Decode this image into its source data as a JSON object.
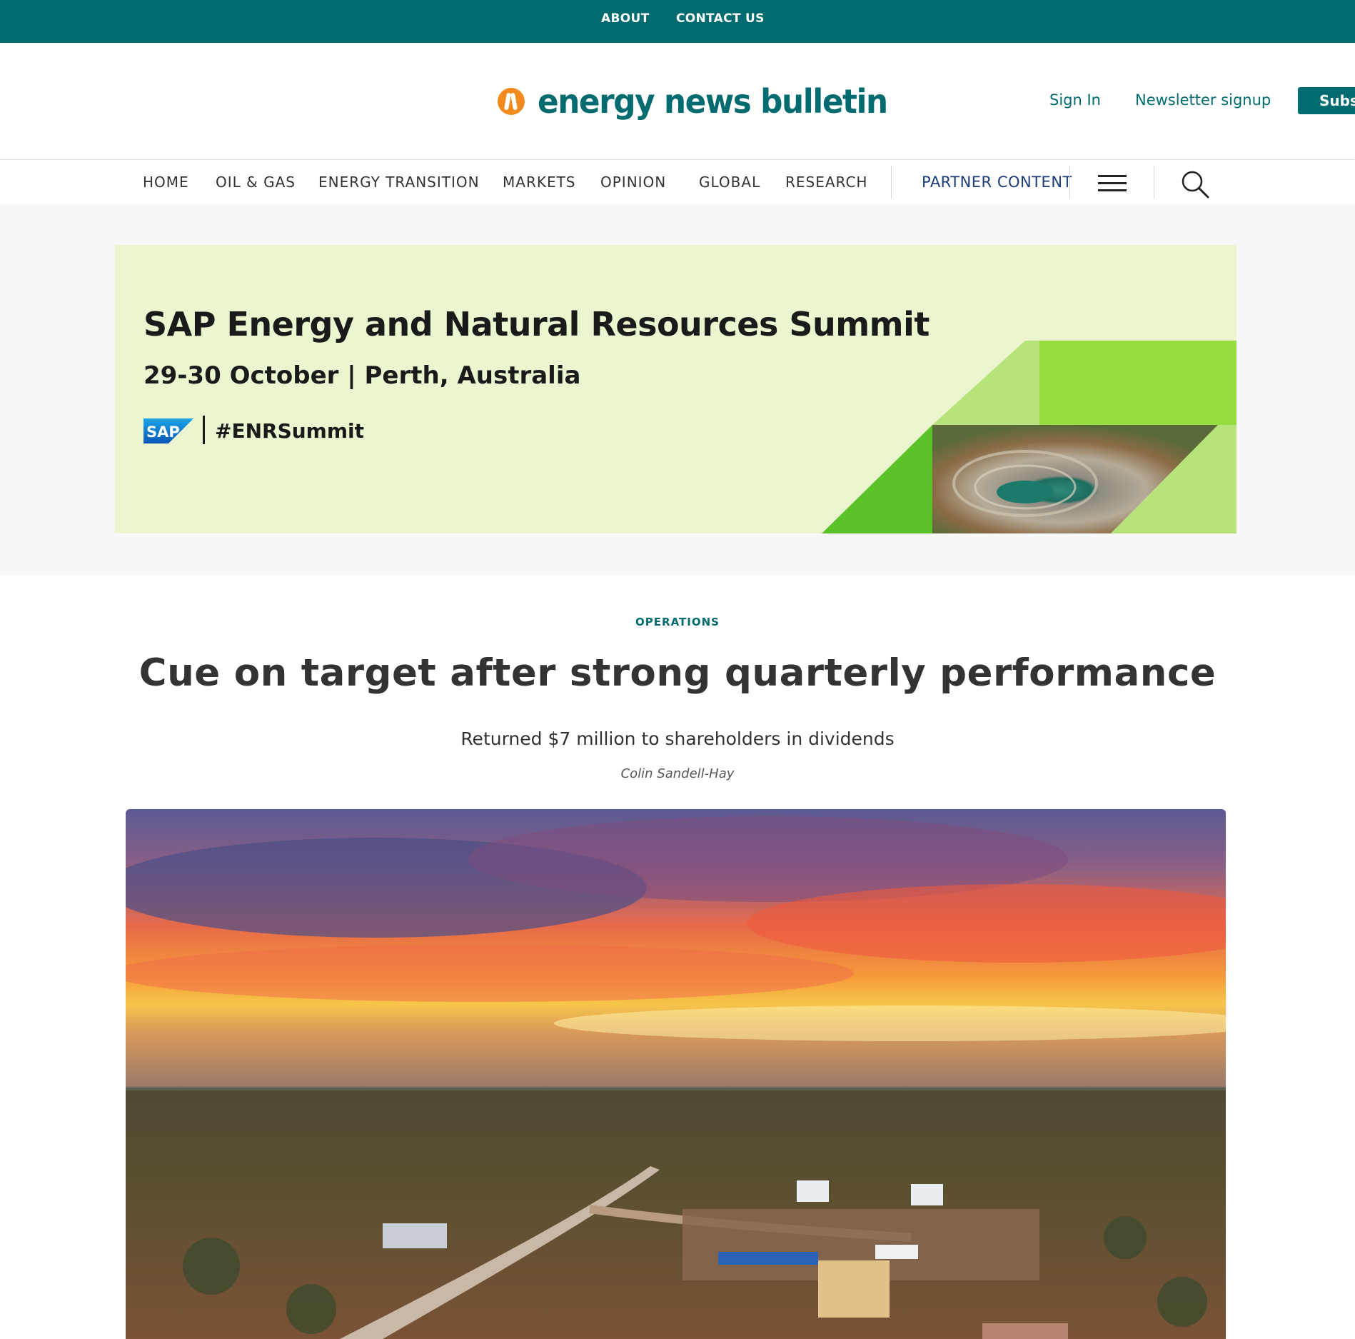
{
  "topbar": {
    "about": "ABOUT",
    "contact": "CONTACT US"
  },
  "header": {
    "logo_text": "energy news bulletin",
    "sign_in": "Sign In",
    "newsletter": "Newsletter signup",
    "subscribe": "Subscribe"
  },
  "nav": {
    "items": [
      "HOME",
      "OIL & GAS",
      "ENERGY TRANSITION",
      "MARKETS",
      "OPINION",
      "GLOBAL",
      "RESEARCH"
    ],
    "partner": "PARTNER CONTENT"
  },
  "ad": {
    "title": "SAP Energy and Natural Resources Summit",
    "date": "29-30 October | Perth, Australia",
    "brand": "SAP",
    "hashtag": "#ENRSummit"
  },
  "article": {
    "category": "OPERATIONS",
    "headline": "Cue on target after strong quarterly performance",
    "subhead": "Returned $7 million to shareholders in dividends",
    "author": "Colin Sandell-Hay"
  },
  "colors": {
    "brand_teal": "#016b6f",
    "logo_orange": "#f28a1e",
    "partner_blue": "#1c3d78",
    "ad_background": "#ebf5cf",
    "ad_green": "#5cc22a"
  },
  "icons": {
    "menu": "hamburger-menu-icon",
    "search": "search-icon",
    "logo": "flame-logo-icon"
  }
}
